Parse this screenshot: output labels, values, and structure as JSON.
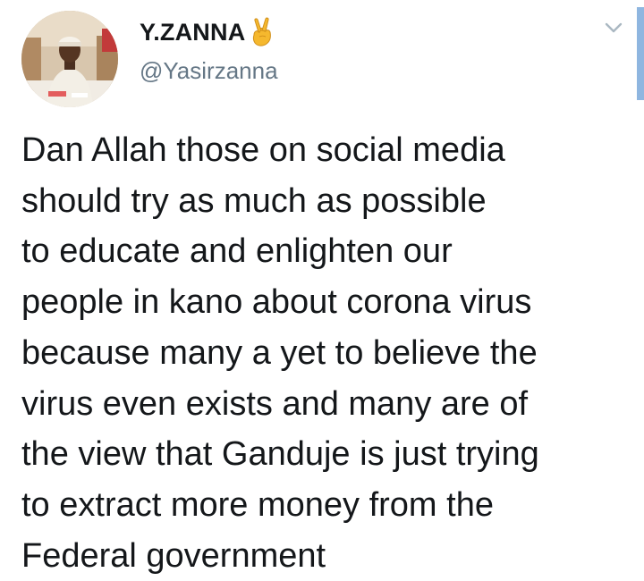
{
  "author": {
    "display_name": "Y.ZANNA",
    "badge_emoji": "victory-hand-emoji",
    "handle": "@Yasirzanna",
    "avatar_icon": "profile-photo"
  },
  "menu": {
    "icon": "chevron-down-icon"
  },
  "tweet": {
    "text": "Dan Allah those on social media\nshould try as much as possible\nto educate and enlighten our\npeople in kano about corona virus\nbecause many a yet to believe the\nvirus even exists and many are of\nthe view that Ganduje is just trying\nto extract more money from the\nFederal government"
  },
  "colors": {
    "text": "#14171a",
    "secondary_text": "#657786",
    "scrollbar": "#8fb6e0",
    "background": "#ffffff"
  }
}
